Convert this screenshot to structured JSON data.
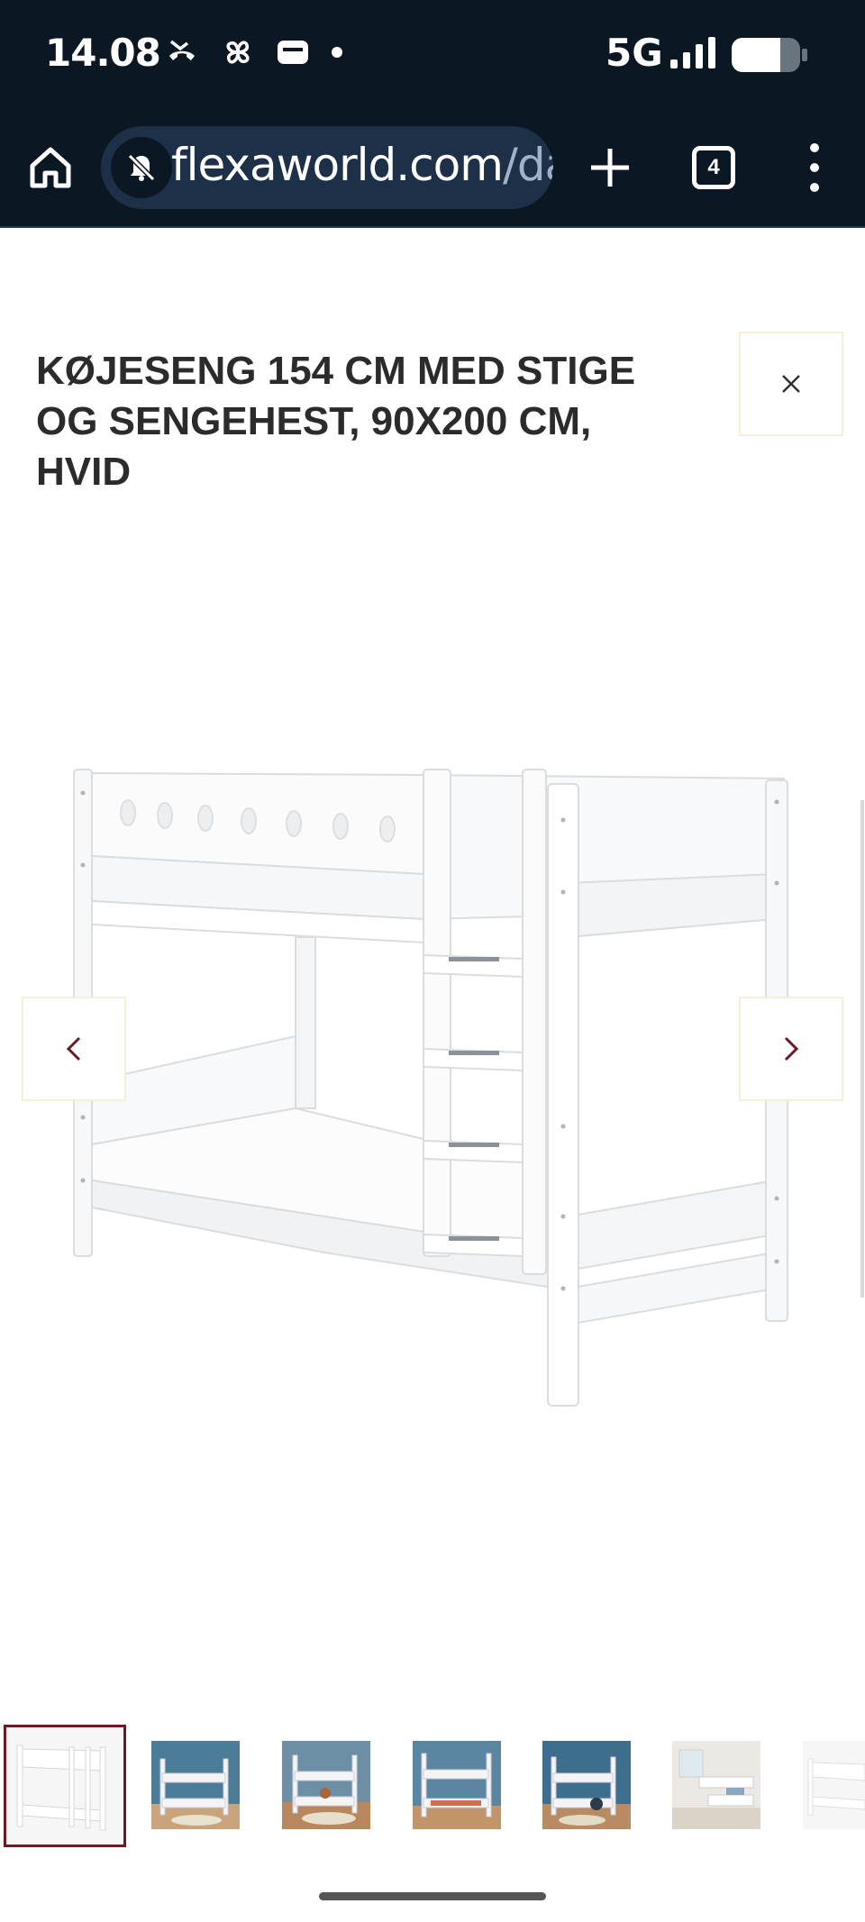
{
  "status_bar": {
    "time": "14.08",
    "network": "5G",
    "icons": [
      "missed-call-icon",
      "pinwheel-icon",
      "wallet-icon",
      "dot-icon",
      "signal-icon",
      "battery-icon"
    ]
  },
  "browser": {
    "url_domain": "flexaworld.com",
    "url_path": "/da-",
    "tab_count": "4",
    "icons": [
      "home-icon",
      "notifications-off-icon",
      "plus-icon",
      "tabs-icon",
      "more-vert-icon"
    ]
  },
  "product": {
    "title": "KØJESENG 154 CM MED STIGE OG SENGEHEST, 90X200 CM, HVID"
  },
  "gallery": {
    "thumbnail_count": 7,
    "active_index": 0
  },
  "colors": {
    "status_bar_bg": "#0b1722",
    "url_pill_bg": "#1d3047",
    "accent": "#6b1a24",
    "button_border": "#f3efd8",
    "title_text": "#2b2b2b"
  }
}
